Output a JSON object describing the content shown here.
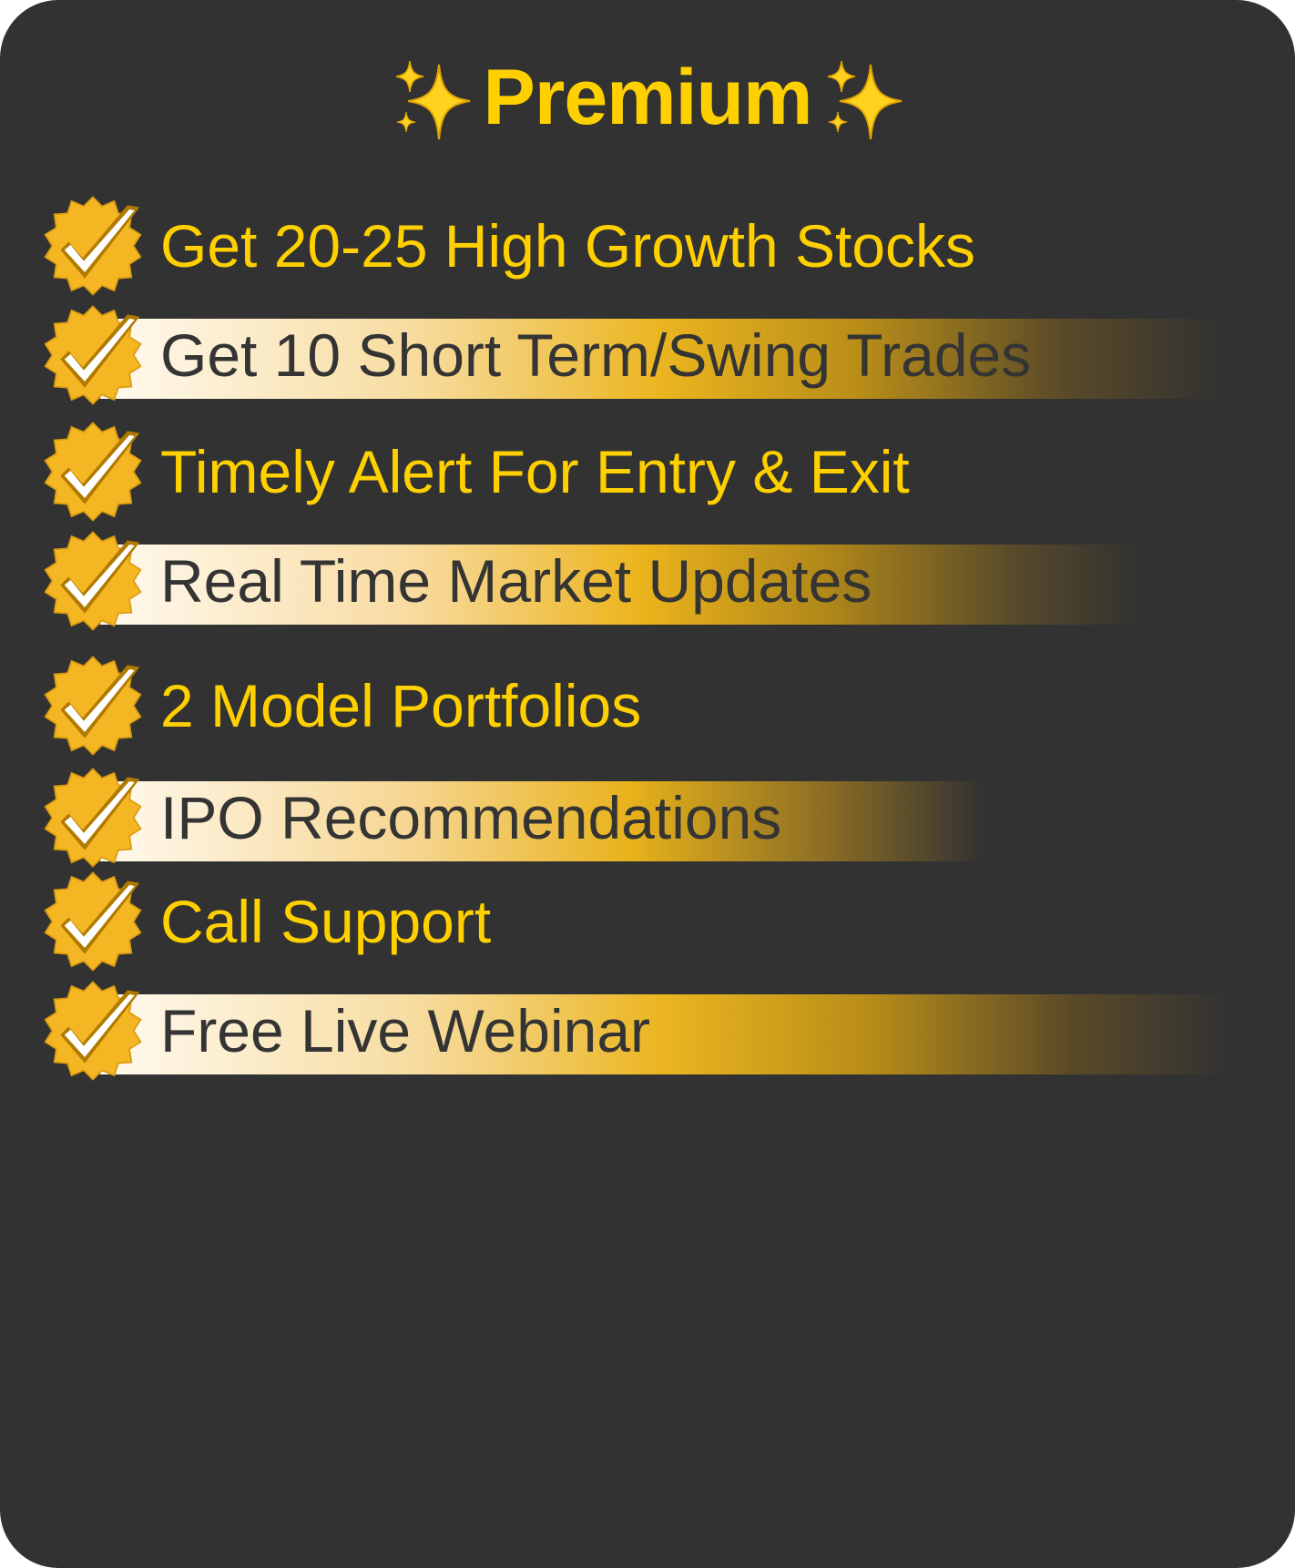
{
  "title": {
    "text": "Premium",
    "left_icon": "sparkles-icon",
    "right_icon": "sparkles-icon"
  },
  "features": [
    {
      "label": "Get 20-25 High Growth Stocks",
      "icon": "check-badge-icon",
      "highlighted": false
    },
    {
      "label": "Get 10 Short Term/Swing Trades",
      "icon": "check-badge-icon",
      "highlighted": true
    },
    {
      "label": "Timely Alert For Entry & Exit",
      "icon": "check-badge-icon",
      "highlighted": false
    },
    {
      "label": "Real Time Market Updates",
      "icon": "check-badge-icon",
      "highlighted": true
    },
    {
      "label": "2 Model Portfolios",
      "icon": "check-badge-icon",
      "highlighted": false
    },
    {
      "label": "IPO Recommendations",
      "icon": "check-badge-icon",
      "highlighted": true
    },
    {
      "label": "Call Support",
      "icon": "check-badge-icon",
      "highlighted": false
    },
    {
      "label": "Free Live Webinar",
      "icon": "check-badge-icon",
      "highlighted": true
    }
  ],
  "colors": {
    "background": "#323232",
    "accent": "#ffd000",
    "badge": "#f5b623",
    "badge_outline": "#b07a00",
    "dark_text": "#343434"
  }
}
